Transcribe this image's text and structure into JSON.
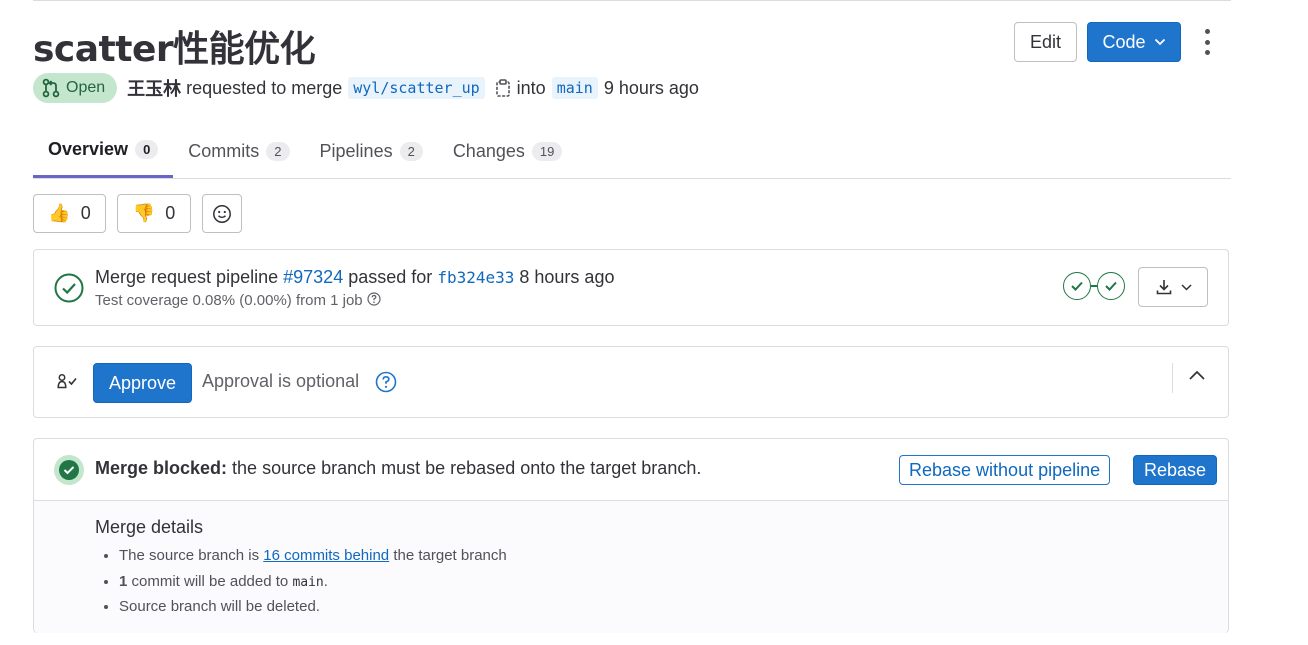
{
  "header": {
    "title": "scatter性能优化",
    "edit_label": "Edit",
    "code_label": "Code"
  },
  "meta": {
    "status": "Open",
    "author": "王玉林",
    "requested_text": "requested to merge",
    "source_branch": "wyl/scatter_up",
    "into_text": "into",
    "target_branch": "main",
    "time": "9 hours ago"
  },
  "tabs": [
    {
      "label": "Overview",
      "count": "0"
    },
    {
      "label": "Commits",
      "count": "2"
    },
    {
      "label": "Pipelines",
      "count": "2"
    },
    {
      "label": "Changes",
      "count": "19"
    }
  ],
  "reactions": {
    "thumbs_up": "0",
    "thumbs_down": "0"
  },
  "pipeline": {
    "prefix": "Merge request pipeline",
    "id": "#97324",
    "passed_for": "passed for",
    "sha": "fb324e33",
    "time": "8 hours ago",
    "coverage": "Test coverage 0.08% (0.00%) from 1 job"
  },
  "approval": {
    "button": "Approve",
    "text": "Approval is optional"
  },
  "merge": {
    "blocked_label": "Merge blocked:",
    "blocked_text": "the source branch must be rebased onto the target branch.",
    "rebase_no_pipeline": "Rebase without pipeline",
    "rebase": "Rebase",
    "details_title": "Merge details",
    "d1_prefix": "The source branch is",
    "d1_link": "16 commits behind",
    "d1_suffix": "the target branch",
    "d2_count": "1",
    "d2_text": "commit will be added to",
    "d2_branch": "main",
    "d2_end": ".",
    "d3": "Source branch will be deleted."
  },
  "colors": {
    "primary": "#1f75cb",
    "success": "#217645",
    "tab_active": "#6666c4"
  }
}
